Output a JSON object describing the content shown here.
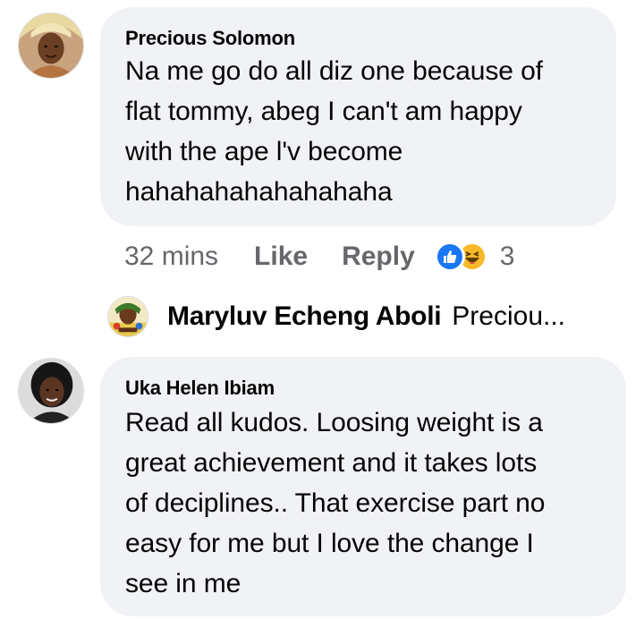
{
  "comments": [
    {
      "author": "Precious Solomon",
      "text_lines": [
        "Na me go do all diz one because of",
        "flat tommy, abeg I can't am happy",
        "with the ape l'v become",
        "hahahahahahahahaha"
      ],
      "time": "32 mins",
      "like_label": "Like",
      "reply_label": "Reply",
      "reaction_icons": [
        "like-icon",
        "haha-icon"
      ],
      "reaction_count": "3",
      "reply_preview": {
        "author": "Maryluv Echeng Aboli",
        "snippet": "Preciou..."
      }
    },
    {
      "author": "Uka Helen Ibiam",
      "text_lines": [
        "Read all kudos. Loosing weight is a",
        "great achievement and it takes lots",
        "of deciplines.. That exercise part no",
        "easy for me but I love the change I",
        "see in me"
      ]
    }
  ],
  "colors": {
    "bubble": "#f0f2f5",
    "secondary_text": "#65676b",
    "like_blue": "#1877f2",
    "haha_yellow": "#f7b928"
  }
}
